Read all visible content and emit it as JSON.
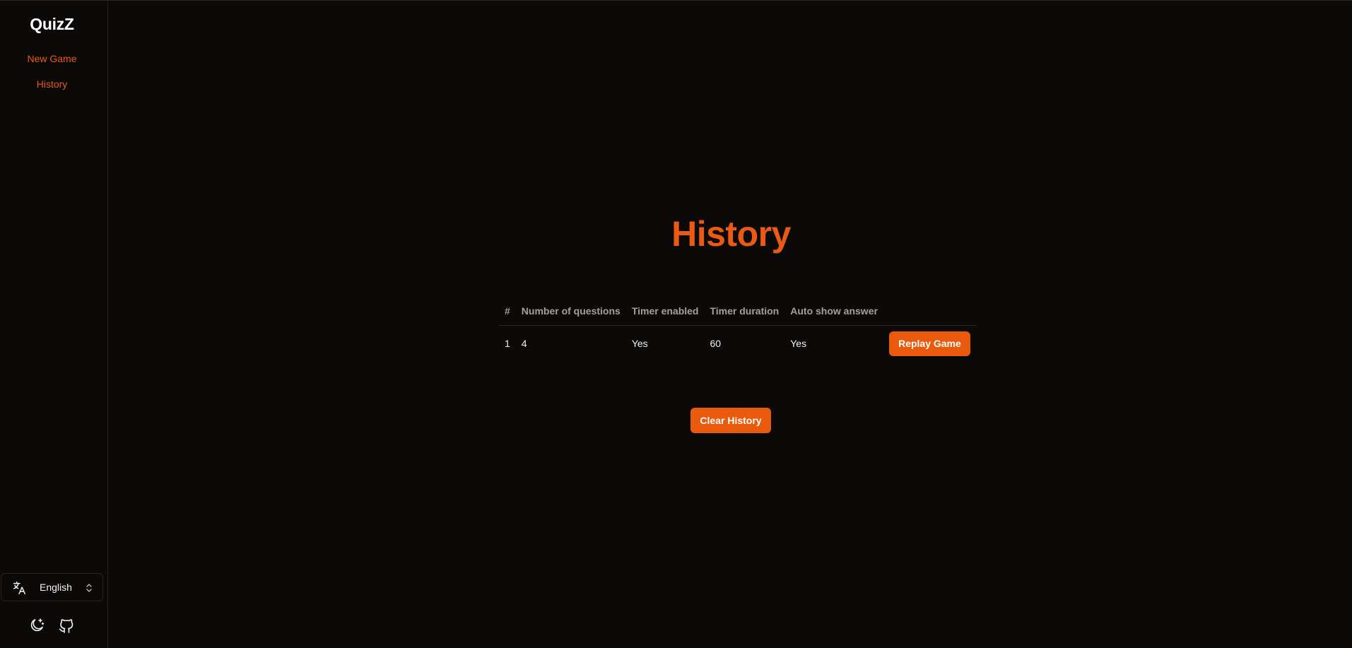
{
  "sidebar": {
    "brand": "QuizZ",
    "nav": [
      {
        "label": "New Game"
      },
      {
        "label": "History"
      }
    ],
    "language": {
      "selected": "English",
      "icon": "translate-icon"
    },
    "footer_icons": [
      "theme-toggle-icon",
      "github-icon"
    ]
  },
  "main": {
    "title": "History",
    "table": {
      "headers": [
        "#",
        "Number of questions",
        "Timer enabled",
        "Timer duration",
        "Auto show answer",
        ""
      ],
      "rows": [
        {
          "index": "1",
          "questions": "4",
          "timer_enabled": "Yes",
          "timer_duration": "60",
          "auto_show_answer": "Yes",
          "action_label": "Replay Game"
        }
      ]
    },
    "clear_label": "Clear History"
  },
  "colors": {
    "accent": "#ea5a0c",
    "background": "#0b0a09",
    "muted_text": "#a3a09c"
  }
}
